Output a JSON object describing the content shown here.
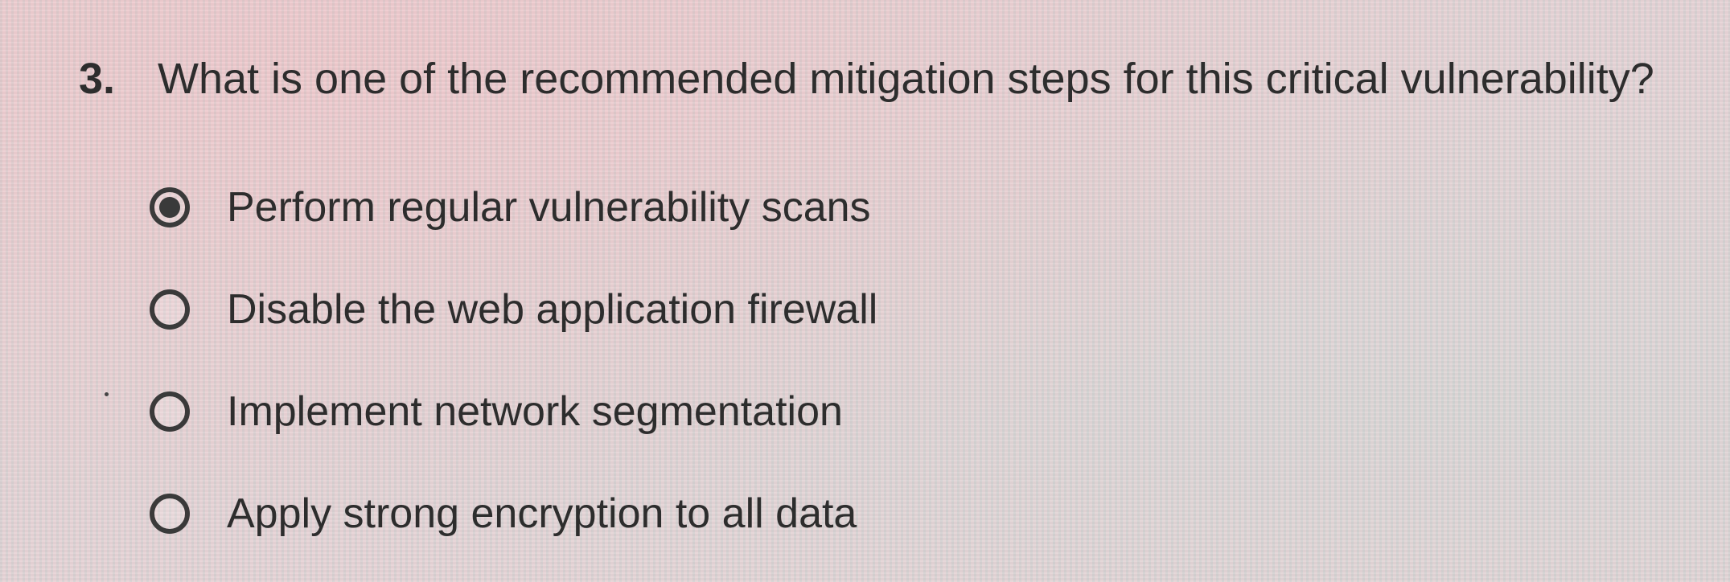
{
  "question": {
    "number": "3.",
    "text": "What is one of the recommended mitigation steps for this critical vulnerability?"
  },
  "options": [
    {
      "label": "Perform regular vulnerability scans",
      "selected": true
    },
    {
      "label": "Disable the web application firewall",
      "selected": false
    },
    {
      "label": "Implement network segmentation",
      "selected": false
    },
    {
      "label": "Apply strong encryption to all data",
      "selected": false
    }
  ]
}
